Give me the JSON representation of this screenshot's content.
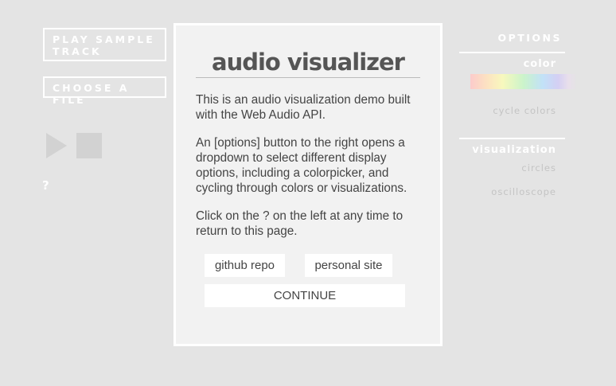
{
  "controls": {
    "play_sample_label": "PLAY SAMPLE TRACK",
    "choose_file_label": "CHOOSE A FILE",
    "play_icon": "play-icon",
    "stop_icon": "stop-icon",
    "help_label": "?"
  },
  "options": {
    "title": "OPTIONS",
    "color_heading": "color",
    "cycle_colors_label": "cycle colors",
    "visualization_heading": "visualization",
    "items": [
      "circles",
      "oscilloscope"
    ]
  },
  "modal": {
    "title": "audio visualizer",
    "paragraphs": [
      "This is an audio visualization demo built with the Web Audio API.",
      "An [options] button to the right opens a dropdown to select different display options, including a colorpicker, and cycling through colors or visualizations.",
      "Click on the ? on the left at any time to return to this page."
    ],
    "github_label": "github repo",
    "personal_label": "personal site",
    "continue_label": "CONTINUE"
  },
  "colors": {
    "background": "#e4e4e4",
    "modal_background": "#f2f2f2",
    "text": "#444444",
    "title": "#555555",
    "muted": "#c4c4c4",
    "white": "#ffffff"
  }
}
